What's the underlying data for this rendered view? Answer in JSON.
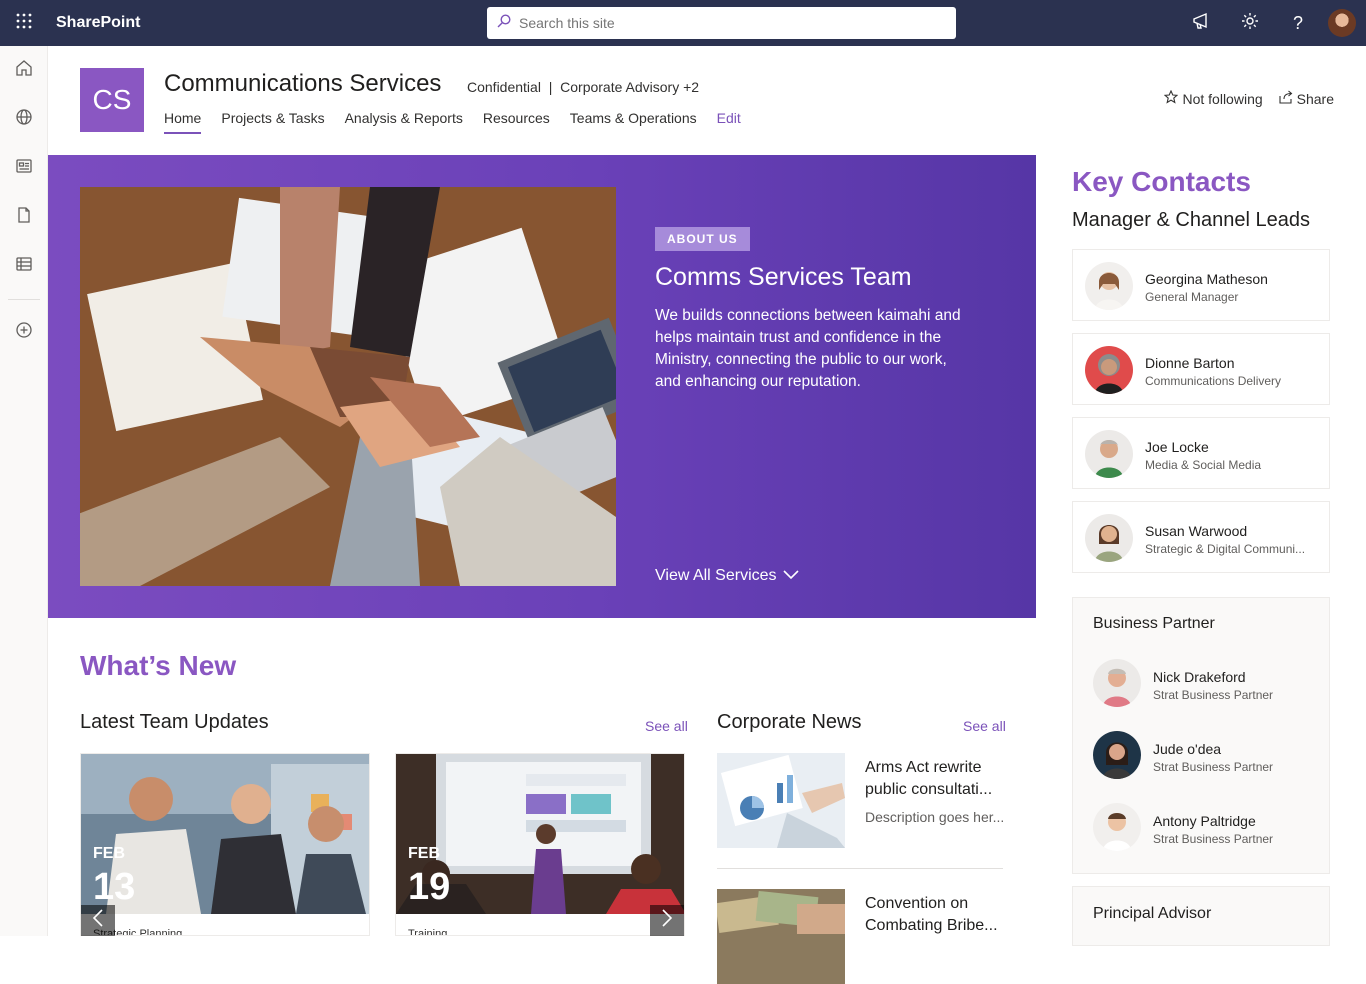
{
  "suite": {
    "app_name": "SharePoint",
    "search_placeholder": "Search this site"
  },
  "site": {
    "logo_text": "CS",
    "title": "Communications Services",
    "meta": "Confidential  |  Corporate Advisory +2",
    "nav": [
      "Home",
      "Projects & Tasks",
      "Analysis & Reports",
      "Resources",
      "Teams & Operations"
    ],
    "nav_edit": "Edit",
    "follow_label": "Not following",
    "share_label": "Share"
  },
  "hero": {
    "badge": "ABOUT US",
    "title": "Comms Services Team",
    "description": "We builds connections between kaimahi and helps maintain trust and confidence in the Ministry, connecting the public to our work, and enhancing our reputation.",
    "link": "View All Services"
  },
  "whats_new": {
    "heading": "What’s New",
    "updates": {
      "title": "Latest Team Updates",
      "see_all": "See all",
      "cards": [
        {
          "month": "FEB",
          "day": "13",
          "category": "Strategic Planning"
        },
        {
          "month": "FEB",
          "day": "19",
          "category": "Training"
        }
      ]
    },
    "news": {
      "title": "Corporate News",
      "see_all": "See all",
      "items": [
        {
          "title": "Arms Act rewrite public consultati...",
          "description": "Description goes her..."
        },
        {
          "title": "Convention on Combating Bribe..."
        }
      ]
    }
  },
  "key_contacts": {
    "heading": "Key Contacts",
    "subheading": "Manager & Channel Leads",
    "leads": [
      {
        "name": "Georgina Matheson",
        "role": "General Manager"
      },
      {
        "name": "Dionne Barton",
        "role": "Communications Delivery"
      },
      {
        "name": "Joe Locke",
        "role": "Media & Social Media"
      },
      {
        "name": "Susan Warwood",
        "role": "Strategic & Digital Communi..."
      }
    ],
    "business_partner": {
      "title": "Business Partner",
      "people": [
        {
          "name": "Nick Drakeford",
          "role": "Strat Business Partner"
        },
        {
          "name": "Jude o'dea",
          "role": "Strat Business Partner"
        },
        {
          "name": "Antony Paltridge",
          "role": "Strat Business Partner"
        }
      ]
    },
    "principal_advisor": {
      "title": "Principal Advisor"
    }
  },
  "colors": {
    "suite_bar": "#2b3250",
    "accent": "#8a57c2",
    "hero_bg": "#6a41b8"
  },
  "icons": [
    "waffle-icon",
    "search-icon",
    "megaphone-icon",
    "gear-icon",
    "help-icon",
    "home-icon",
    "globe-icon",
    "news-icon",
    "document-icon",
    "list-icon",
    "add-icon",
    "star-icon",
    "share-icon",
    "chevron-down-icon",
    "chevron-left-icon",
    "chevron-right-icon"
  ]
}
